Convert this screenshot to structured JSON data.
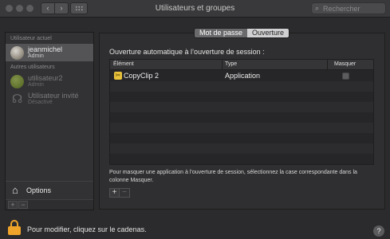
{
  "window": {
    "title": "Utilisateurs et groupes"
  },
  "toolbar": {
    "back_glyph": "‹",
    "forward_glyph": "›",
    "search_placeholder": "Rechercher"
  },
  "sidebar": {
    "current_user_header": "Utilisateur actuel",
    "other_users_header": "Autres utilisateurs",
    "users": [
      {
        "name": "jeanmichel",
        "role": "Admin",
        "avatar": "user-avatar-photo"
      },
      {
        "name": "utilisateur2",
        "role": "Admin",
        "avatar": "green-ball-avatar"
      },
      {
        "name": "Utilisateur invité",
        "role": "Désactivé",
        "avatar": "guest-user-icon"
      }
    ],
    "options_label": "Options",
    "add_glyph": "+",
    "remove_glyph": "−"
  },
  "tabs": {
    "password": "Mot de passe",
    "login_items": "Ouverture",
    "selected": "login_items"
  },
  "login_items": {
    "heading": "Ouverture automatique à l’ouverture de session :",
    "columns": {
      "item": "Élément",
      "type": "Type",
      "hide": "Masquer"
    },
    "rows": [
      {
        "name": "CopyClip 2",
        "type": "Application",
        "hide": false,
        "icon": "copyclip-app-icon"
      }
    ],
    "note": "Pour masquer une application à l’ouverture de session, sélectionnez la case correspondante dans la colonne Masquer.",
    "add_glyph": "+",
    "remove_glyph": "−"
  },
  "footer": {
    "lock_text": "Pour modifier, cliquez sur le cadenas.",
    "help_glyph": "?"
  },
  "colors": {
    "background": "#2b2b2d",
    "lock": "#f0a42a",
    "selected_tab": "#d0d0d2"
  }
}
